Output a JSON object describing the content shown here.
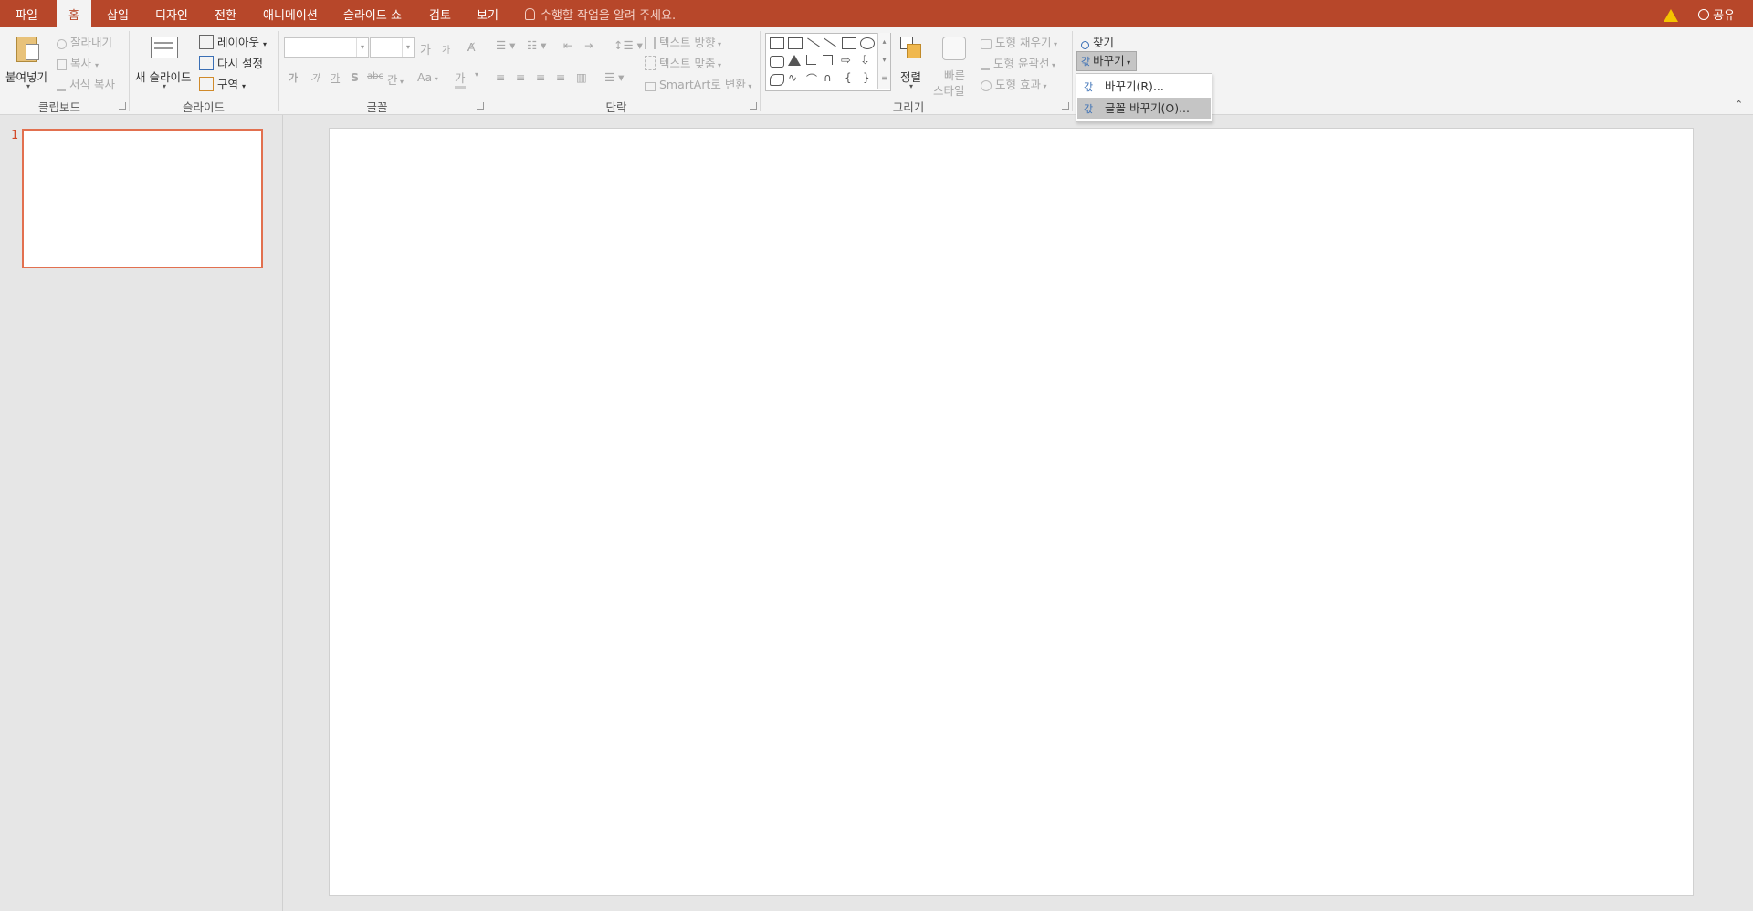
{
  "tabs": [
    {
      "label": "파일",
      "active": false
    },
    {
      "label": "홈",
      "active": true
    },
    {
      "label": "삽입",
      "active": false
    },
    {
      "label": "디자인",
      "active": false
    },
    {
      "label": "전환",
      "active": false
    },
    {
      "label": "애니메이션",
      "active": false
    },
    {
      "label": "슬라이드 쇼",
      "active": false
    },
    {
      "label": "검토",
      "active": false
    },
    {
      "label": "보기",
      "active": false
    }
  ],
  "tell_me": "수행할 작업을 알려 주세요.",
  "share": "공유",
  "clipboard": {
    "group_label": "클립보드",
    "paste": "붙여넣기",
    "cut": "잘라내기",
    "copy": "복사",
    "format_painter": "서식 복사"
  },
  "slides_group": {
    "group_label": "슬라이드",
    "new_slide": "새 슬라이드",
    "layout": "레이아웃",
    "reset": "다시 설정",
    "section": "구역"
  },
  "font": {
    "group_label": "글꼴",
    "font_name": "",
    "font_size": "",
    "grow": "가",
    "shrink": "가",
    "bold": "가",
    "italic": "가",
    "underline": "가",
    "shadow": "S",
    "strike": "abc",
    "spacing": "간",
    "case": "Aa",
    "color": "가"
  },
  "paragraph": {
    "group_label": "단락",
    "text_direction": "텍스트 방향",
    "align_text": "텍스트 맞춤",
    "smartart": "SmartArt로 변환"
  },
  "drawing": {
    "group_label": "그리기",
    "arrange": "정렬",
    "quick_styles_1": "빠른",
    "quick_styles_2": "스타일",
    "shape_fill": "도형 채우기",
    "shape_outline": "도형 윤곽선",
    "shape_effects": "도형 효과"
  },
  "editing": {
    "find": "찾기",
    "replace": "바꾸기"
  },
  "replace_menu": {
    "item_replace": "바꾸기(R)...",
    "item_replace_fonts": "글꼴 바꾸기(O)..."
  },
  "thumbnails": {
    "slide_number": "1"
  },
  "colors": {
    "accent": "#b7472a",
    "thumb_border": "#e2704f"
  }
}
